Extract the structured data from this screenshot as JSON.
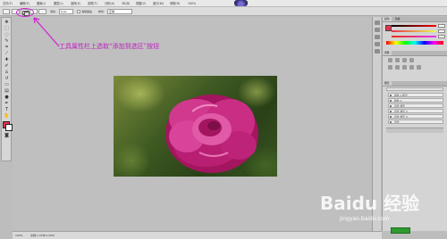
{
  "menubar": {
    "items": [
      "文件(F)",
      "编辑(E)",
      "图像(I)",
      "图层(L)",
      "选择(S)",
      "滤镜(T)",
      "分析(A)",
      "3D(D)",
      "视图(V)",
      "窗口(W)",
      "帮助(H)"
    ],
    "zoom": "100%"
  },
  "options": {
    "feather_label": "羽化:",
    "feather_value": "0 px",
    "antialias_label": "消除锯齿",
    "style_label": "样式:",
    "style_value": "正常"
  },
  "annotation": {
    "text": "工具属性栏上选取“添加到选区”按钮"
  },
  "panels": {
    "color_tab": "颜色",
    "swatches_tab": "色板",
    "adjust_tab": "调整",
    "layers_tab": "图层",
    "layer_rows": [
      "颜色 1 拷贝",
      "颜色 1",
      "背景 拷贝",
      "背景 拷贝 2",
      "背景 拷贝 3",
      "背景"
    ]
  },
  "status": {
    "zoom": "100%",
    "doc": "文档:1.22M/1.22M"
  },
  "watermark": {
    "logo_text": "Baidu 经验",
    "url": "jingyan.baidu.com"
  },
  "colors": {
    "highlight": "#d11fd1",
    "foreground": "#e8304c",
    "rose": "#c2277a"
  }
}
